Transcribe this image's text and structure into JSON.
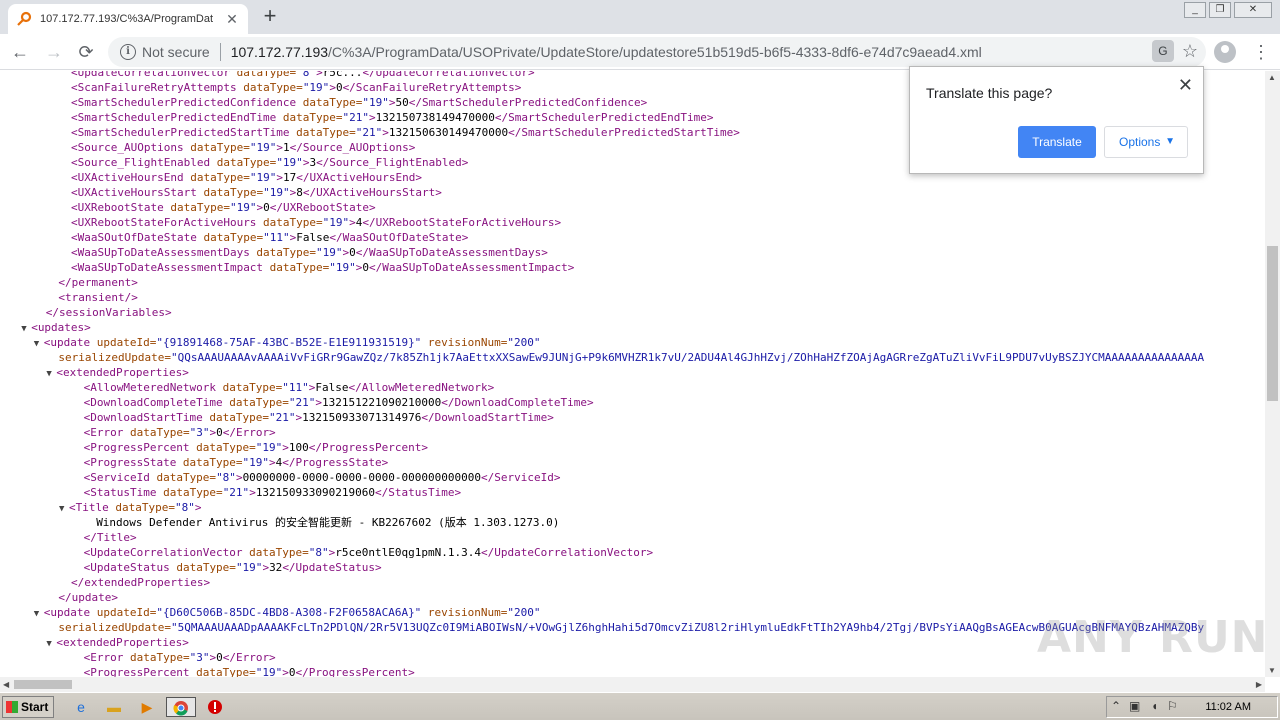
{
  "tab": {
    "title": "107.172.77.193/C%3A/ProgramDat",
    "close": "✕",
    "new_tab": "+"
  },
  "window_controls": {
    "minimize": "_",
    "restore": "❐",
    "close": "✕"
  },
  "toolbar": {
    "back": "←",
    "forward": "→",
    "reload": "⟳",
    "security_label": "Not secure",
    "url_host": "107.172.77.193",
    "url_path": "/C%3A/ProgramData/USOPrivate/UpdateStore/updatestore51b519d5-b6f5-4333-8df6-e74d7c9aead4.xml",
    "translate_glyph": "G",
    "star_glyph": "☆",
    "menu_glyph": "⋮"
  },
  "translate_popup": {
    "title": "Translate this page?",
    "close": "✕",
    "translate_button": "Translate",
    "options_button": "Options",
    "caret": "▼"
  },
  "xml_lines": [
    {
      "indent": 5,
      "tri": "",
      "open": "<",
      "tag": "UpdateCorrelationVector",
      "attr": " dataType=",
      "val": "\"8\"",
      "gt": ">",
      "text": "r5c...",
      "close": "</UpdateCorrelationVector>"
    },
    {
      "indent": 5,
      "tri": "",
      "open": "<",
      "tag": "ScanFailureRetryAttempts",
      "attr": " dataType=",
      "val": "\"19\"",
      "gt": ">",
      "text": "0",
      "close": "</ScanFailureRetryAttempts>"
    },
    {
      "indent": 5,
      "tri": "",
      "open": "<",
      "tag": "SmartSchedulerPredictedConfidence",
      "attr": " dataType=",
      "val": "\"19\"",
      "gt": ">",
      "text": "50",
      "close": "</SmartSchedulerPredictedConfidence>"
    },
    {
      "indent": 5,
      "tri": "",
      "open": "<",
      "tag": "SmartSchedulerPredictedEndTime",
      "attr": " dataType=",
      "val": "\"21\"",
      "gt": ">",
      "text": "132150738149470000",
      "close": "</SmartSchedulerPredictedEndTime>"
    },
    {
      "indent": 5,
      "tri": "",
      "open": "<",
      "tag": "SmartSchedulerPredictedStartTime",
      "attr": " dataType=",
      "val": "\"21\"",
      "gt": ">",
      "text": "132150630149470000",
      "close": "</SmartSchedulerPredictedStartTime>"
    },
    {
      "indent": 5,
      "tri": "",
      "open": "<",
      "tag": "Source_AUOptions",
      "attr": " dataType=",
      "val": "\"19\"",
      "gt": ">",
      "text": "1",
      "close": "</Source_AUOptions>"
    },
    {
      "indent": 5,
      "tri": "",
      "open": "<",
      "tag": "Source_FlightEnabled",
      "attr": " dataType=",
      "val": "\"19\"",
      "gt": ">",
      "text": "3",
      "close": "</Source_FlightEnabled>"
    },
    {
      "indent": 5,
      "tri": "",
      "open": "<",
      "tag": "UXActiveHoursEnd",
      "attr": " dataType=",
      "val": "\"19\"",
      "gt": ">",
      "text": "17",
      "close": "</UXActiveHoursEnd>"
    },
    {
      "indent": 5,
      "tri": "",
      "open": "<",
      "tag": "UXActiveHoursStart",
      "attr": " dataType=",
      "val": "\"19\"",
      "gt": ">",
      "text": "8",
      "close": "</UXActiveHoursStart>"
    },
    {
      "indent": 5,
      "tri": "",
      "open": "<",
      "tag": "UXRebootState",
      "attr": " dataType=",
      "val": "\"19\"",
      "gt": ">",
      "text": "0",
      "close": "</UXRebootState>"
    },
    {
      "indent": 5,
      "tri": "",
      "open": "<",
      "tag": "UXRebootStateForActiveHours",
      "attr": " dataType=",
      "val": "\"19\"",
      "gt": ">",
      "text": "4",
      "close": "</UXRebootStateForActiveHours>"
    },
    {
      "indent": 5,
      "tri": "",
      "open": "<",
      "tag": "WaaSOutOfDateState",
      "attr": " dataType=",
      "val": "\"11\"",
      "gt": ">",
      "text": "False",
      "close": "</WaaSOutOfDateState>"
    },
    {
      "indent": 5,
      "tri": "",
      "open": "<",
      "tag": "WaaSUpToDateAssessmentDays",
      "attr": " dataType=",
      "val": "\"19\"",
      "gt": ">",
      "text": "0",
      "close": "</WaaSUpToDateAssessmentDays>"
    },
    {
      "indent": 5,
      "tri": "",
      "open": "<",
      "tag": "WaaSUpToDateAssessmentImpact",
      "attr": " dataType=",
      "val": "\"19\"",
      "gt": ">",
      "text": "0",
      "close": "</WaaSUpToDateAssessmentImpact>"
    },
    {
      "indent": 4,
      "tri": "",
      "open": "",
      "tag": "",
      "attr": "",
      "val": "",
      "gt": "",
      "text": "",
      "close": "</permanent>"
    },
    {
      "indent": 4,
      "tri": "",
      "open": "<",
      "tag": "transient",
      "attr": "",
      "val": "",
      "gt": "/>",
      "text": "",
      "close": ""
    },
    {
      "indent": 3,
      "tri": "",
      "open": "",
      "tag": "",
      "attr": "",
      "val": "",
      "gt": "",
      "text": "",
      "close": "</sessionVariables>"
    },
    {
      "indent": 2,
      "tri": "▼",
      "open": "<",
      "tag": "updates",
      "attr": "",
      "val": "",
      "gt": ">",
      "text": "",
      "close": ""
    },
    {
      "indent": 3,
      "tri": "▼",
      "open": "<",
      "tag": "update",
      "attr": " updateId=",
      "val": "\"{91891468-75AF-43BC-B52E-E1E911931519}\"",
      "gt": "",
      "text": "",
      "close": "",
      "attr2": " revisionNum=",
      "val2": "\"200\""
    },
    {
      "indent": 4,
      "tri": "",
      "open": "",
      "tag": "",
      "attr": "serializedUpdate=",
      "val": "\"QQsAAAUAAAAvAAAAiVvFiGRr9GawZQz/7k85Zh1jk7AaEttxXXSawEw9JUNjG+P9k6MVHZR1k7vU/2ADU4Al4GJhHZvj/ZOhHaHZfZOAjAgAGRreZgATuZliVvFiL9PDU7vUyBSZJYCMAAAAAAAAAAAAAAA",
      "gt": "",
      "text": "",
      "close": ""
    },
    {
      "indent": 4,
      "tri": "▼",
      "open": "<",
      "tag": "extendedProperties",
      "attr": "",
      "val": "",
      "gt": ">",
      "text": "",
      "close": ""
    },
    {
      "indent": 6,
      "tri": "",
      "open": "<",
      "tag": "AllowMeteredNetwork",
      "attr": " dataType=",
      "val": "\"11\"",
      "gt": ">",
      "text": "False",
      "close": "</AllowMeteredNetwork>"
    },
    {
      "indent": 6,
      "tri": "",
      "open": "<",
      "tag": "DownloadCompleteTime",
      "attr": " dataType=",
      "val": "\"21\"",
      "gt": ">",
      "text": "132151221090210000",
      "close": "</DownloadCompleteTime>"
    },
    {
      "indent": 6,
      "tri": "",
      "open": "<",
      "tag": "DownloadStartTime",
      "attr": " dataType=",
      "val": "\"21\"",
      "gt": ">",
      "text": "132150933071314976",
      "close": "</DownloadStartTime>"
    },
    {
      "indent": 6,
      "tri": "",
      "open": "<",
      "tag": "Error",
      "attr": " dataType=",
      "val": "\"3\"",
      "gt": ">",
      "text": "0",
      "close": "</Error>"
    },
    {
      "indent": 6,
      "tri": "",
      "open": "<",
      "tag": "ProgressPercent",
      "attr": " dataType=",
      "val": "\"19\"",
      "gt": ">",
      "text": "100",
      "close": "</ProgressPercent>"
    },
    {
      "indent": 6,
      "tri": "",
      "open": "<",
      "tag": "ProgressState",
      "attr": " dataType=",
      "val": "\"19\"",
      "gt": ">",
      "text": "4",
      "close": "</ProgressState>"
    },
    {
      "indent": 6,
      "tri": "",
      "open": "<",
      "tag": "ServiceId",
      "attr": " dataType=",
      "val": "\"8\"",
      "gt": ">",
      "text": "00000000-0000-0000-0000-000000000000",
      "close": "</ServiceId>"
    },
    {
      "indent": 6,
      "tri": "",
      "open": "<",
      "tag": "StatusTime",
      "attr": " dataType=",
      "val": "\"21\"",
      "gt": ">",
      "text": "132150933090219060",
      "close": "</StatusTime>"
    },
    {
      "indent": 5,
      "tri": "▼",
      "open": "<",
      "tag": "Title",
      "attr": " dataType=",
      "val": "\"8\"",
      "gt": ">",
      "text": "",
      "close": ""
    },
    {
      "indent": 7,
      "tri": "",
      "open": "",
      "tag": "",
      "attr": "",
      "val": "",
      "gt": "",
      "text": "Windows Defender Antivirus 的安全智能更新 - KB2267602 (版本 1.303.1273.0)",
      "close": ""
    },
    {
      "indent": 6,
      "tri": "",
      "open": "",
      "tag": "",
      "attr": "",
      "val": "",
      "gt": "",
      "text": "",
      "close": "</Title>"
    },
    {
      "indent": 6,
      "tri": "",
      "open": "<",
      "tag": "UpdateCorrelationVector",
      "attr": " dataType=",
      "val": "\"8\"",
      "gt": ">",
      "text": "r5ce0ntlE0qg1pmN.1.3.4",
      "close": "</UpdateCorrelationVector>"
    },
    {
      "indent": 6,
      "tri": "",
      "open": "<",
      "tag": "UpdateStatus",
      "attr": " dataType=",
      "val": "\"19\"",
      "gt": ">",
      "text": "32",
      "close": "</UpdateStatus>"
    },
    {
      "indent": 5,
      "tri": "",
      "open": "",
      "tag": "",
      "attr": "",
      "val": "",
      "gt": "",
      "text": "",
      "close": "</extendedProperties>"
    },
    {
      "indent": 4,
      "tri": "",
      "open": "",
      "tag": "",
      "attr": "",
      "val": "",
      "gt": "",
      "text": "",
      "close": "</update>"
    },
    {
      "indent": 3,
      "tri": "▼",
      "open": "<",
      "tag": "update",
      "attr": " updateId=",
      "val": "\"{D60C506B-85DC-4BD8-A308-F2F0658ACA6A}\"",
      "gt": "",
      "text": "",
      "close": "",
      "attr2": " revisionNum=",
      "val2": "\"200\""
    },
    {
      "indent": 4,
      "tri": "",
      "open": "",
      "tag": "",
      "attr": "serializedUpdate=",
      "val": "\"5QMAAAUAAADpAAAAKFcLTn2PDlQN/2Rr5V13UQZc0I9MiABOIWsN/+VOwGjlZ6hghHahi5d7OmcvZiZU8l2riHlymluEdkFtTIh2YA9hb4/2Tgj/BVPsYiAAQgBsAGEAcwB0AGUAcgBNFMAYQBzAHMAZQBy",
      "gt": "",
      "text": "",
      "close": ""
    },
    {
      "indent": 4,
      "tri": "▼",
      "open": "<",
      "tag": "extendedProperties",
      "attr": "",
      "val": "",
      "gt": ">",
      "text": "",
      "close": ""
    },
    {
      "indent": 6,
      "tri": "",
      "open": "<",
      "tag": "Error",
      "attr": " dataType=",
      "val": "\"3\"",
      "gt": ">",
      "text": "0",
      "close": "</Error>"
    },
    {
      "indent": 6,
      "tri": "",
      "open": "<",
      "tag": "ProgressPercent",
      "attr": " dataType=",
      "val": "\"19\"",
      "gt": ">",
      "text": "0",
      "close": "</ProgressPercent>"
    }
  ],
  "watermark": "ANY RUN",
  "taskbar": {
    "start_label": "Start",
    "clock": "11:02 AM"
  }
}
